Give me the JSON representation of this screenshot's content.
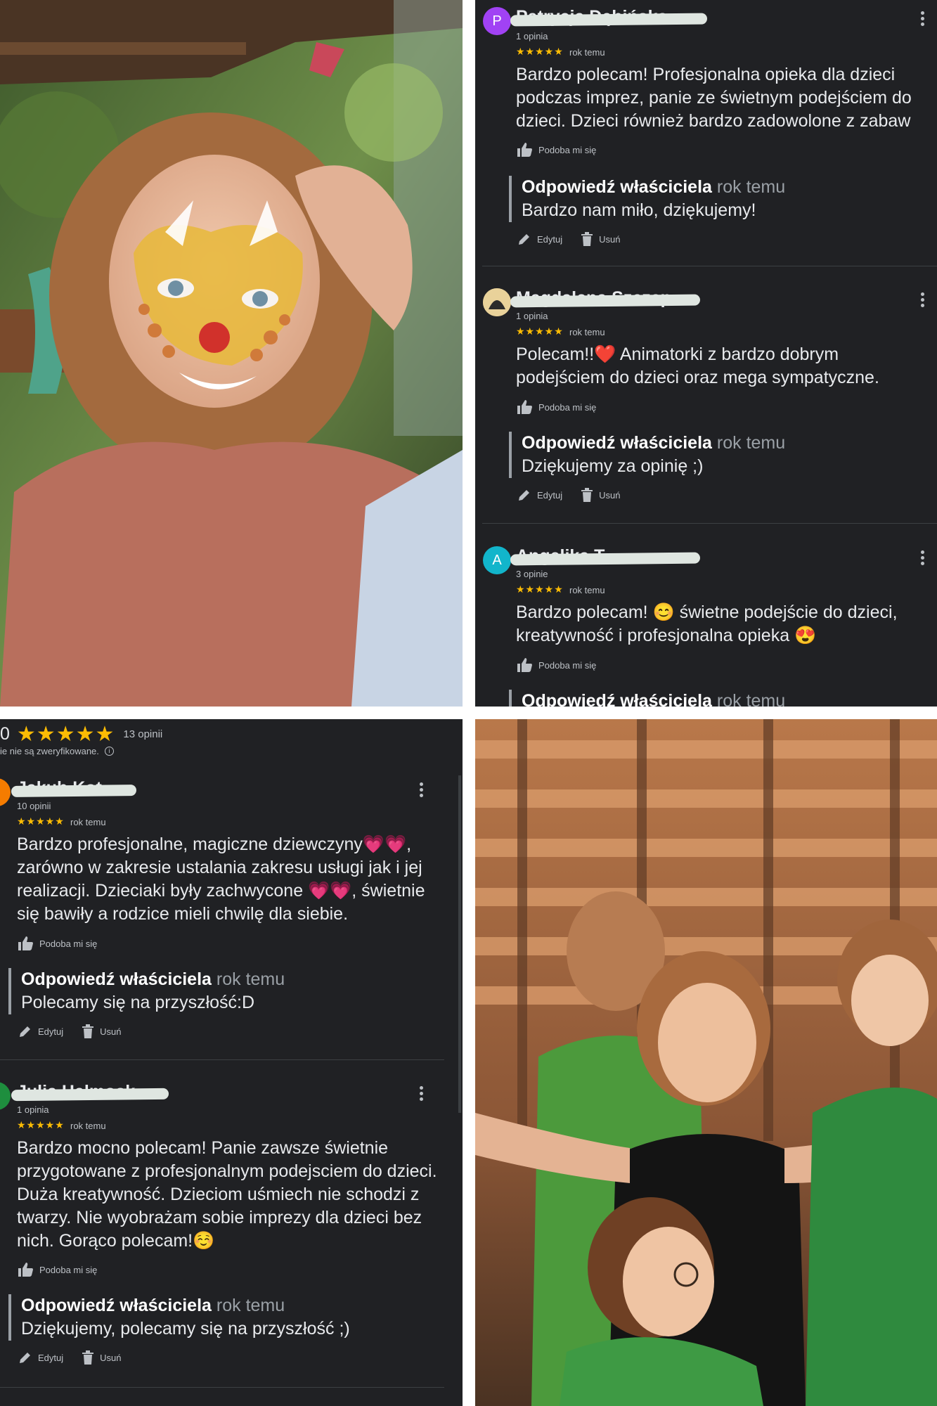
{
  "colors": {
    "dark_bg": "#202124",
    "star": "#fbbc04",
    "text": "#e8eaed",
    "muted": "#bdc1c6"
  },
  "photos": {
    "top_left": "girl-with-cat-face-paint",
    "bottom_right": "children-dancing-in-gym"
  },
  "summary": {
    "rating": "0",
    "stars": "★★★★★",
    "count": "13 opinii",
    "note": "ie nie są zweryfikowane."
  },
  "top_right_reviews": [
    {
      "avatar": "P",
      "avatar_color": "#a142f4",
      "name": "Patrycja Dębińska",
      "count": "1 opinia",
      "stars": "★★★★★",
      "time": "rok temu",
      "text": "Bardzo polecam! Profesjonalna opieka dla dzieci podczas imprez, panie ze świetnym podejściem do dzieci. Dzieci również bardzo zadowolone z zabaw",
      "like": "Podoba mi się",
      "reply_label": "Odpowiedź właściciela",
      "reply_time": "rok temu",
      "reply_text": "Bardzo nam miło, dziękujemy!",
      "edit": "Edytuj",
      "delete": "Usuń"
    },
    {
      "avatar": "",
      "avatar_color": "#c8a35a",
      "name": "Magdalena Szczep",
      "count": "1 opinia",
      "stars": "★★★★★",
      "time": "rok temu",
      "text": "Polecam!!❤️ Animatorki z bardzo dobrym podejściem do dzieci oraz mega sympatyczne.",
      "like": "Podoba mi się",
      "reply_label": "Odpowiedź właściciela",
      "reply_time": "rok temu",
      "reply_text": "Dziękujemy za opinię ;)",
      "edit": "Edytuj",
      "delete": "Usuń"
    },
    {
      "avatar": "A",
      "avatar_color": "#12b5cb",
      "name": "Angelika T",
      "count": "3 opinie",
      "stars": "★★★★★",
      "time": "rok temu",
      "text": "Bardzo polecam! 😊 świetne podejście do dzieci, kreatywność i profesjonalna opieka 😍",
      "like": "Podoba mi się",
      "reply_label": "Odpowiedź właściciela",
      "reply_time": "rok temu"
    }
  ],
  "bottom_left_reviews": [
    {
      "avatar_color": "#f57c00",
      "name": "Jakub Kot",
      "count": "10 opinii",
      "stars": "★★★★★",
      "time": "rok temu",
      "text": "Bardzo profesjonalne, magiczne dziewczyny💗💗, zarówno w zakresie ustalania zakresu usługi jak i jej realizacji. Dzieciaki były zachwycone 💗💗, świetnie się bawiły a rodzice mieli chwilę dla siebie.",
      "like": "Podoba mi się",
      "reply_label": "Odpowiedź właściciela",
      "reply_time": "rok temu",
      "reply_text": "Polecamy się na przyszłość:D",
      "edit": "Edytuj",
      "delete": "Usuń"
    },
    {
      "avatar_color": "#1e8e3e",
      "name": "Julia Halmosk",
      "count": "1 opinia",
      "stars": "★★★★★",
      "time": "rok temu",
      "text": "Bardzo mocno polecam! Panie zawsze świetnie przygotowane z profesjonalnym podejsciem do dzieci. Duża kreatywność. Dzieciom uśmiech nie schodzi z twarzy. Nie wyobrażam sobie imprezy dla dzieci bez nich. Gorąco polecam!☺️",
      "like": "Podoba mi się",
      "reply_label": "Odpowiedź właściciela",
      "reply_time": "rok temu",
      "reply_text": "Dziękujemy, polecamy się na przyszłość ;)",
      "edit": "Edytuj",
      "delete": "Usuń"
    }
  ]
}
